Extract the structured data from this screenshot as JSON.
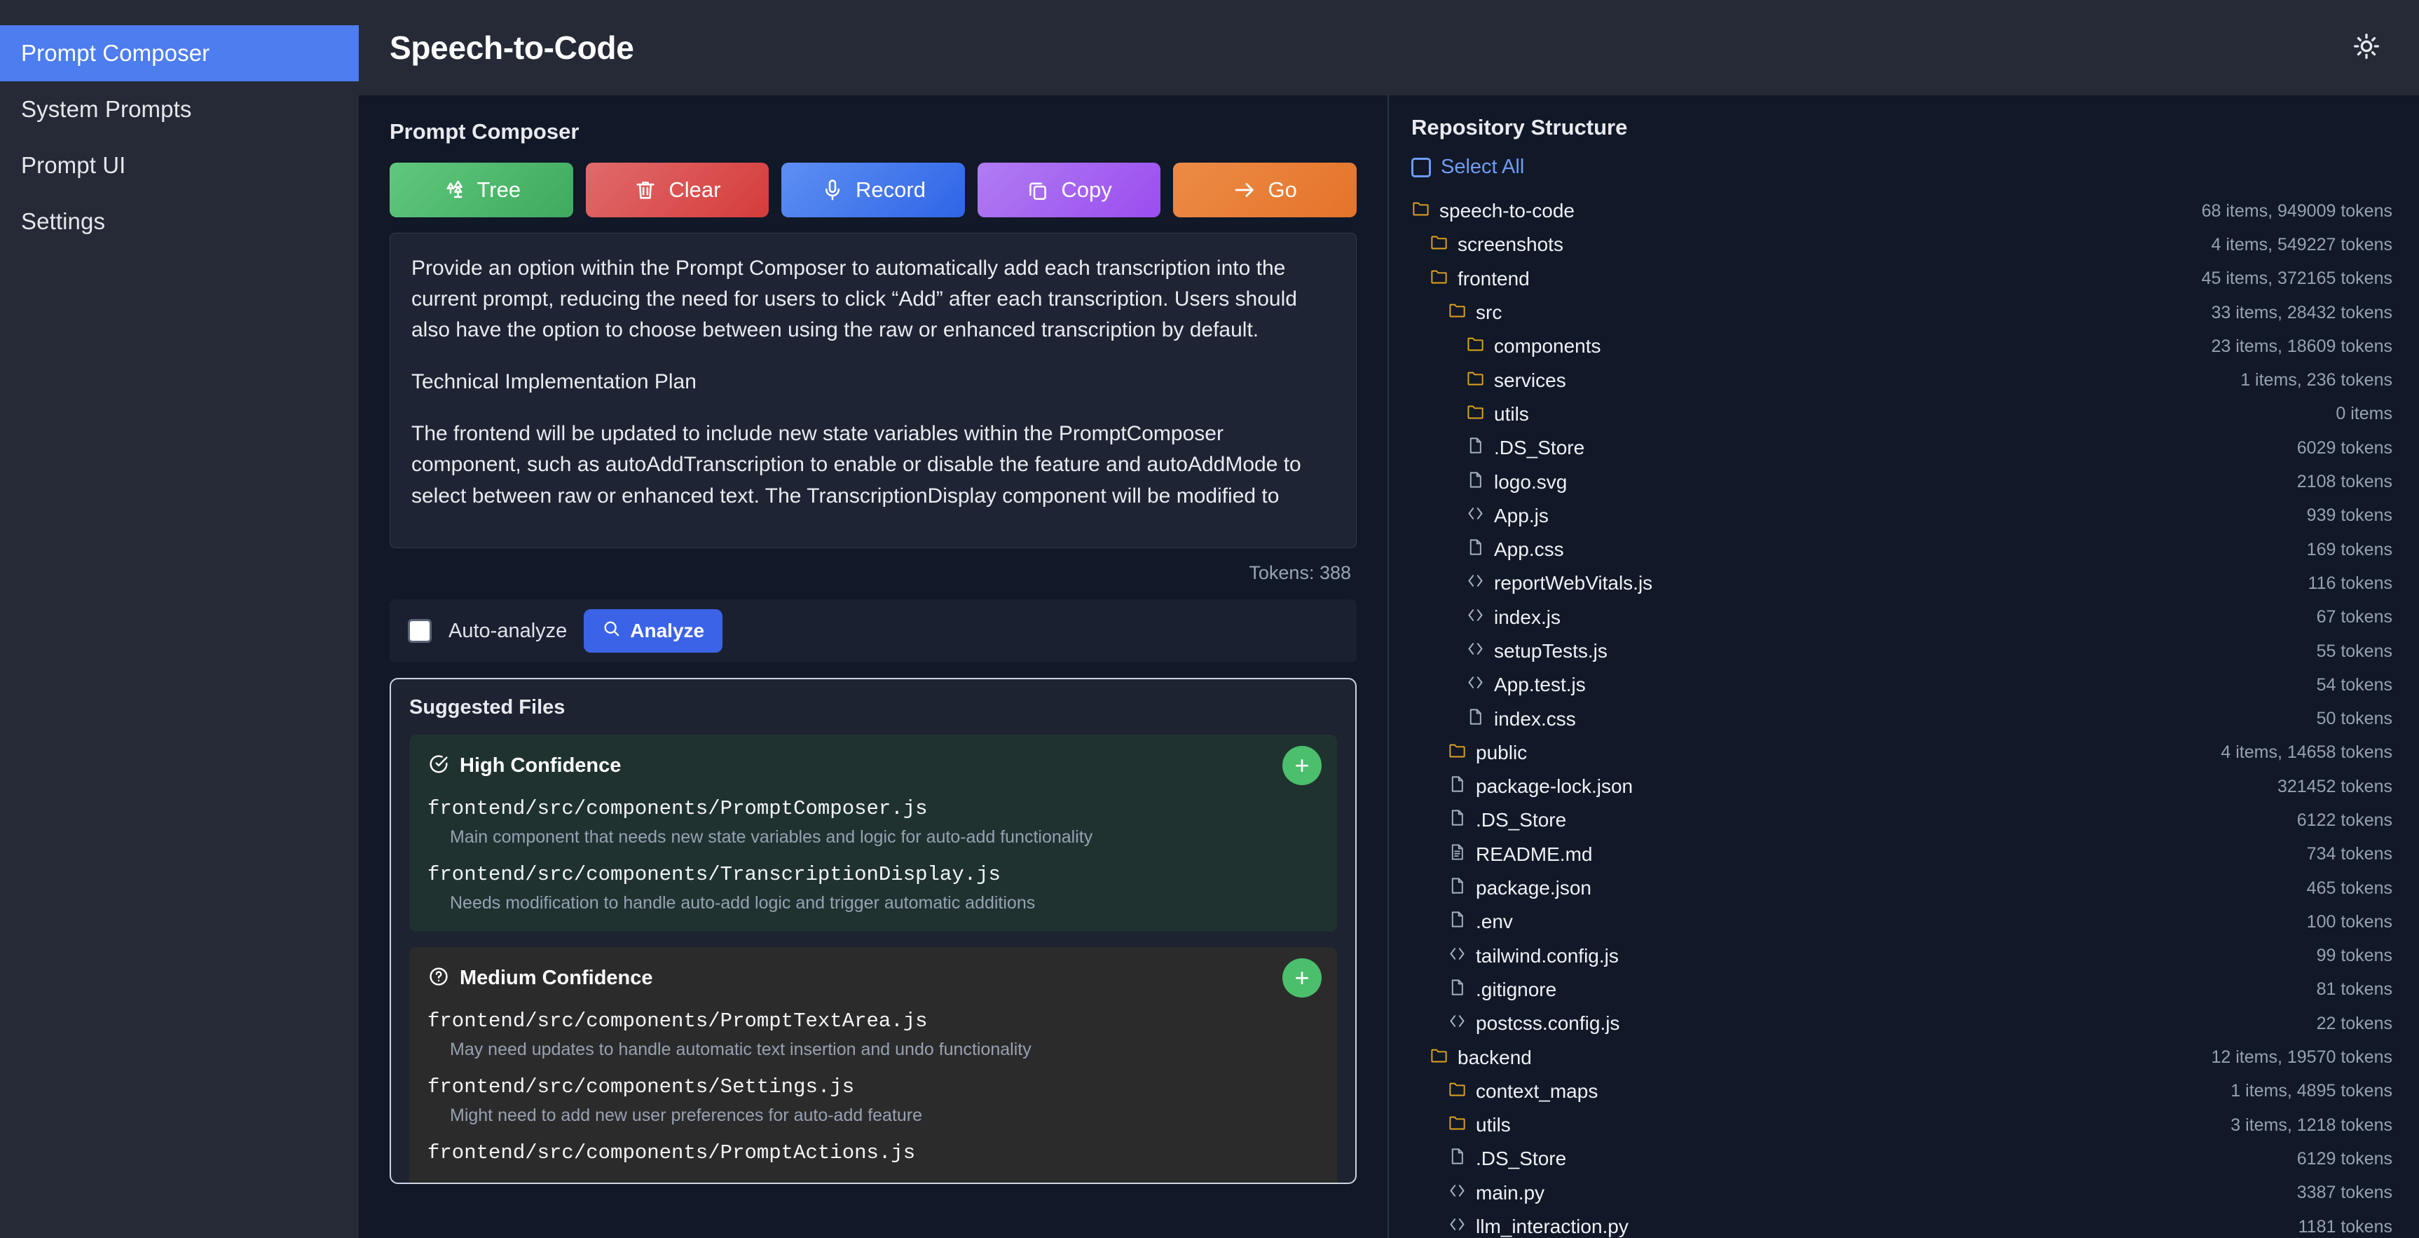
{
  "app": {
    "title": "Speech-to-Code",
    "theme_toggle_icon": "sun-icon"
  },
  "sidebar": {
    "items": [
      {
        "label": "Prompt Composer",
        "active": true
      },
      {
        "label": "System Prompts",
        "active": false
      },
      {
        "label": "Prompt UI",
        "active": false
      },
      {
        "label": "Settings",
        "active": false
      }
    ]
  },
  "composer": {
    "section_title": "Prompt Composer",
    "toolbar": [
      {
        "label": "Tree",
        "icon": "tree-icon",
        "color": "#4fbd6f"
      },
      {
        "label": "Clear",
        "icon": "trash-icon",
        "color": "#d94b4b"
      },
      {
        "label": "Record",
        "icon": "microphone-icon",
        "color": "#3f74ea"
      },
      {
        "label": "Copy",
        "icon": "copy-icon",
        "color": "#a45df1"
      },
      {
        "label": "Go",
        "icon": "arrow-right-icon",
        "color": "#e87c36"
      }
    ],
    "prompt_paragraphs": [
      "Provide an option within the Prompt Composer to automatically add each transcription into the current prompt, reducing the need for users to click “Add” after each transcription. Users should also have the option to choose between using the raw or enhanced transcription by default.",
      "Technical Implementation Plan",
      "The frontend will be updated to include new state variables within the PromptComposer component, such as autoAddTranscription to enable or disable the feature and autoAddMode to select between raw or enhanced text. The TranscriptionDisplay component will be modified to"
    ],
    "token_count": "Tokens: 388",
    "auto_analyze_label": "Auto-analyze",
    "auto_analyze_checked": false,
    "analyze_label": "Analyze",
    "analyze_icon": "search-icon"
  },
  "suggested_files": {
    "title": "Suggested Files",
    "add_icon": "plus-icon",
    "groups": [
      {
        "label": "High Confidence",
        "icon": "check-circle-icon",
        "files": [
          {
            "path": "frontend/src/components/PromptComposer.js",
            "desc": "Main component that needs new state variables and logic for auto-add functionality"
          },
          {
            "path": "frontend/src/components/TranscriptionDisplay.js",
            "desc": "Needs modification to handle auto-add logic and trigger automatic additions"
          }
        ]
      },
      {
        "label": "Medium Confidence",
        "icon": "question-circle-icon",
        "files": [
          {
            "path": "frontend/src/components/PromptTextArea.js",
            "desc": "May need updates to handle automatic text insertion and undo functionality"
          },
          {
            "path": "frontend/src/components/Settings.js",
            "desc": "Might need to add new user preferences for auto-add feature"
          },
          {
            "path": "frontend/src/components/PromptActions.js",
            "desc": ""
          }
        ]
      }
    ]
  },
  "repository": {
    "title": "Repository Structure",
    "select_all_label": "Select All",
    "select_all_checked": false,
    "tree": [
      {
        "name": "speech-to-code",
        "meta": "68 items, 949009 tokens",
        "type": "folder",
        "indent": 0
      },
      {
        "name": "screenshots",
        "meta": "4 items, 549227 tokens",
        "type": "folder",
        "indent": 1
      },
      {
        "name": "frontend",
        "meta": "45 items, 372165 tokens",
        "type": "folder",
        "indent": 1
      },
      {
        "name": "src",
        "meta": "33 items, 28432 tokens",
        "type": "folder",
        "indent": 2
      },
      {
        "name": "components",
        "meta": "23 items, 18609 tokens",
        "type": "folder",
        "indent": 3
      },
      {
        "name": "services",
        "meta": "1 items, 236 tokens",
        "type": "folder",
        "indent": 3
      },
      {
        "name": "utils",
        "meta": "0 items",
        "type": "folder",
        "indent": 3
      },
      {
        "name": ".DS_Store",
        "meta": "6029 tokens",
        "type": "file",
        "indent": 3
      },
      {
        "name": "logo.svg",
        "meta": "2108 tokens",
        "type": "file",
        "indent": 3
      },
      {
        "name": "App.js",
        "meta": "939 tokens",
        "type": "code",
        "indent": 3
      },
      {
        "name": "App.css",
        "meta": "169 tokens",
        "type": "file",
        "indent": 3
      },
      {
        "name": "reportWebVitals.js",
        "meta": "116 tokens",
        "type": "code",
        "indent": 3
      },
      {
        "name": "index.js",
        "meta": "67 tokens",
        "type": "code",
        "indent": 3
      },
      {
        "name": "setupTests.js",
        "meta": "55 tokens",
        "type": "code",
        "indent": 3
      },
      {
        "name": "App.test.js",
        "meta": "54 tokens",
        "type": "code",
        "indent": 3
      },
      {
        "name": "index.css",
        "meta": "50 tokens",
        "type": "file",
        "indent": 3
      },
      {
        "name": "public",
        "meta": "4 items, 14658 tokens",
        "type": "folder",
        "indent": 2
      },
      {
        "name": "package-lock.json",
        "meta": "321452 tokens",
        "type": "file",
        "indent": 2
      },
      {
        "name": ".DS_Store",
        "meta": "6122 tokens",
        "type": "file",
        "indent": 2
      },
      {
        "name": "README.md",
        "meta": "734 tokens",
        "type": "doc",
        "indent": 2
      },
      {
        "name": "package.json",
        "meta": "465 tokens",
        "type": "file",
        "indent": 2
      },
      {
        "name": ".env",
        "meta": "100 tokens",
        "type": "file",
        "indent": 2
      },
      {
        "name": "tailwind.config.js",
        "meta": "99 tokens",
        "type": "code",
        "indent": 2
      },
      {
        "name": ".gitignore",
        "meta": "81 tokens",
        "type": "file",
        "indent": 2
      },
      {
        "name": "postcss.config.js",
        "meta": "22 tokens",
        "type": "code",
        "indent": 2
      },
      {
        "name": "backend",
        "meta": "12 items, 19570 tokens",
        "type": "folder",
        "indent": 1
      },
      {
        "name": "context_maps",
        "meta": "1 items, 4895 tokens",
        "type": "folder",
        "indent": 2
      },
      {
        "name": "utils",
        "meta": "3 items, 1218 tokens",
        "type": "folder",
        "indent": 2
      },
      {
        "name": ".DS_Store",
        "meta": "6129 tokens",
        "type": "file",
        "indent": 2
      },
      {
        "name": "main.py",
        "meta": "3387 tokens",
        "type": "code",
        "indent": 2
      },
      {
        "name": "llm_interaction.py",
        "meta": "1181 tokens",
        "type": "code",
        "indent": 2
      }
    ]
  }
}
